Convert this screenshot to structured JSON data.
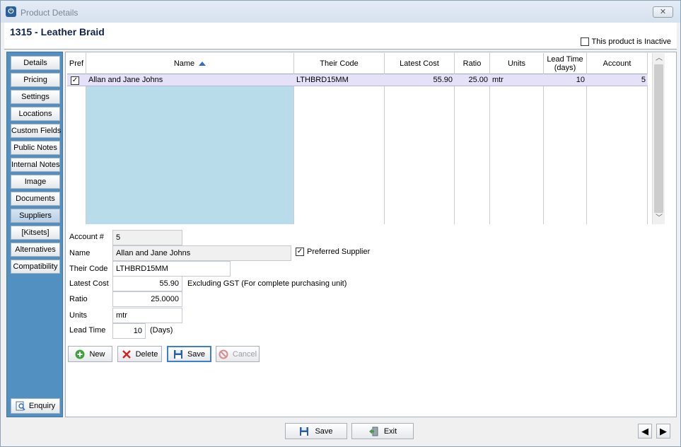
{
  "window": {
    "title": "Product Details",
    "close_glyph": "✕",
    "app_icon_glyph": "⏻"
  },
  "product": {
    "title": "1315 - Leather Braid",
    "inactive_label": "This product is Inactive",
    "inactive_checked": false
  },
  "sidebar": {
    "items": [
      {
        "label": "Details"
      },
      {
        "label": "Pricing"
      },
      {
        "label": "Settings"
      },
      {
        "label": "Locations"
      },
      {
        "label": "Custom Fields"
      },
      {
        "label": "Public Notes"
      },
      {
        "label": "Internal Notes"
      },
      {
        "label": "Image"
      },
      {
        "label": "Documents"
      },
      {
        "label": "Suppliers",
        "active": true
      },
      {
        "label": "[Kitsets]"
      },
      {
        "label": "Alternatives"
      },
      {
        "label": "Compatibility"
      }
    ],
    "enquiry_label": "Enquiry"
  },
  "grid": {
    "columns": [
      {
        "label": "Pref"
      },
      {
        "label": "Name",
        "sorted": "asc"
      },
      {
        "label": "Their Code"
      },
      {
        "label": "Latest Cost"
      },
      {
        "label": "Ratio"
      },
      {
        "label": "Units"
      },
      {
        "label": "Lead Time (days)"
      },
      {
        "label": "Account"
      }
    ],
    "rows": [
      {
        "pref": true,
        "name": "Allan and Jane Johns",
        "their_code": "LTHBRD15MM",
        "latest_cost": "55.90",
        "ratio": "25.00",
        "units": "mtr",
        "lead_time": "10",
        "account": "5"
      }
    ]
  },
  "form": {
    "account_label": "Account #",
    "account_value": "5",
    "name_label": "Name",
    "name_value": "Allan and Jane Johns",
    "preferred_label": "Preferred Supplier",
    "preferred_checked": true,
    "their_code_label": "Their Code",
    "their_code_value": "LTHBRD15MM",
    "latest_cost_label": "Latest Cost",
    "latest_cost_value": "55.90",
    "latest_cost_note": "Excluding GST (For complete purchasing unit)",
    "ratio_label": "Ratio",
    "ratio_value": "25.0000",
    "units_label": "Units",
    "units_value": "mtr",
    "lead_time_label": "Lead Time",
    "lead_time_value": "10",
    "lead_time_suffix": "(Days)"
  },
  "actions": {
    "new_label": "New",
    "delete_label": "Delete",
    "save_label": "Save",
    "cancel_label": "Cancel"
  },
  "footer": {
    "save_label": "Save",
    "exit_label": "Exit",
    "prev_glyph": "◀",
    "next_glyph": "▶"
  },
  "colors": {
    "sidebar_bg": "#5190c0",
    "row_selected": "#e4e1f8",
    "name_column": "#b8dcea",
    "title_text": "#10244a"
  }
}
